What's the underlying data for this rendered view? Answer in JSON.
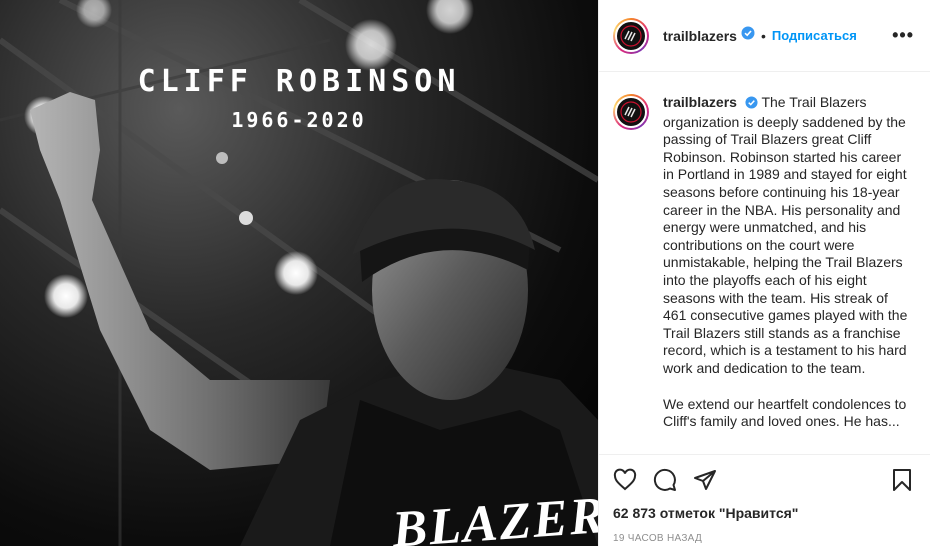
{
  "media": {
    "title_name": "CLIFF ROBINSON",
    "title_years": "1966-2020",
    "jersey_text": "BLAZERS"
  },
  "header": {
    "username": "trailblazers",
    "separator": "•",
    "follow_label": "Подписаться",
    "more_label": "•••"
  },
  "caption": {
    "username": "trailblazers",
    "paragraph1": "The Trail Blazers organization is deeply saddened by the passing of Trail Blazers great Cliff Robinson. Robinson started his career in Portland in 1989 and stayed for eight seasons before continuing his 18-year career in the NBA. His personality and energy were unmatched, and his contributions on the court were unmistakable, helping the Trail Blazers into the playoffs each of his eight seasons with the team. His streak of 461 consecutive games played with the Trail Blazers still stands as a franchise record, which is a testament to his hard work and dedication to the team.",
    "paragraph2": "We extend our heartfelt condolences to Cliff's family and loved ones. He has..."
  },
  "actions": {
    "icons": [
      "heart-icon",
      "comment-icon",
      "share-icon",
      "bookmark-icon"
    ],
    "likes": "62 873 отметок \"Нравится\"",
    "timestamp": "19 ЧАСОВ НАЗАД"
  },
  "colors": {
    "accent": "#0095f6",
    "verified": "#3897f0",
    "text": "#262626",
    "muted": "#8e8e8e"
  }
}
